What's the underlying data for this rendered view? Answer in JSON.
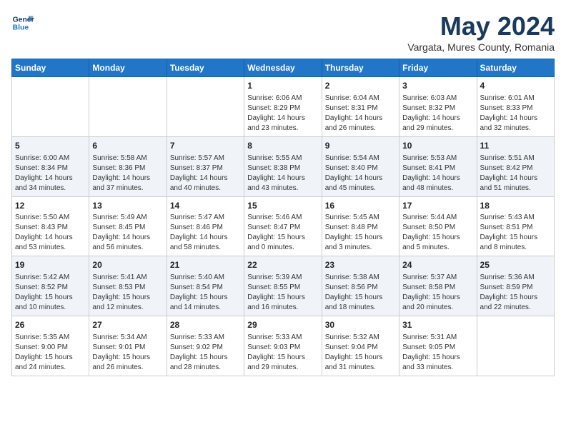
{
  "logo": {
    "line1": "General",
    "line2": "Blue"
  },
  "title": "May 2024",
  "location": "Vargata, Mures County, Romania",
  "weekdays": [
    "Sunday",
    "Monday",
    "Tuesday",
    "Wednesday",
    "Thursday",
    "Friday",
    "Saturday"
  ],
  "weeks": [
    [
      {
        "day": "",
        "info": ""
      },
      {
        "day": "",
        "info": ""
      },
      {
        "day": "",
        "info": ""
      },
      {
        "day": "1",
        "info": "Sunrise: 6:06 AM\nSunset: 8:29 PM\nDaylight: 14 hours\nand 23 minutes."
      },
      {
        "day": "2",
        "info": "Sunrise: 6:04 AM\nSunset: 8:31 PM\nDaylight: 14 hours\nand 26 minutes."
      },
      {
        "day": "3",
        "info": "Sunrise: 6:03 AM\nSunset: 8:32 PM\nDaylight: 14 hours\nand 29 minutes."
      },
      {
        "day": "4",
        "info": "Sunrise: 6:01 AM\nSunset: 8:33 PM\nDaylight: 14 hours\nand 32 minutes."
      }
    ],
    [
      {
        "day": "5",
        "info": "Sunrise: 6:00 AM\nSunset: 8:34 PM\nDaylight: 14 hours\nand 34 minutes."
      },
      {
        "day": "6",
        "info": "Sunrise: 5:58 AM\nSunset: 8:36 PM\nDaylight: 14 hours\nand 37 minutes."
      },
      {
        "day": "7",
        "info": "Sunrise: 5:57 AM\nSunset: 8:37 PM\nDaylight: 14 hours\nand 40 minutes."
      },
      {
        "day": "8",
        "info": "Sunrise: 5:55 AM\nSunset: 8:38 PM\nDaylight: 14 hours\nand 43 minutes."
      },
      {
        "day": "9",
        "info": "Sunrise: 5:54 AM\nSunset: 8:40 PM\nDaylight: 14 hours\nand 45 minutes."
      },
      {
        "day": "10",
        "info": "Sunrise: 5:53 AM\nSunset: 8:41 PM\nDaylight: 14 hours\nand 48 minutes."
      },
      {
        "day": "11",
        "info": "Sunrise: 5:51 AM\nSunset: 8:42 PM\nDaylight: 14 hours\nand 51 minutes."
      }
    ],
    [
      {
        "day": "12",
        "info": "Sunrise: 5:50 AM\nSunset: 8:43 PM\nDaylight: 14 hours\nand 53 minutes."
      },
      {
        "day": "13",
        "info": "Sunrise: 5:49 AM\nSunset: 8:45 PM\nDaylight: 14 hours\nand 56 minutes."
      },
      {
        "day": "14",
        "info": "Sunrise: 5:47 AM\nSunset: 8:46 PM\nDaylight: 14 hours\nand 58 minutes."
      },
      {
        "day": "15",
        "info": "Sunrise: 5:46 AM\nSunset: 8:47 PM\nDaylight: 15 hours\nand 0 minutes."
      },
      {
        "day": "16",
        "info": "Sunrise: 5:45 AM\nSunset: 8:48 PM\nDaylight: 15 hours\nand 3 minutes."
      },
      {
        "day": "17",
        "info": "Sunrise: 5:44 AM\nSunset: 8:50 PM\nDaylight: 15 hours\nand 5 minutes."
      },
      {
        "day": "18",
        "info": "Sunrise: 5:43 AM\nSunset: 8:51 PM\nDaylight: 15 hours\nand 8 minutes."
      }
    ],
    [
      {
        "day": "19",
        "info": "Sunrise: 5:42 AM\nSunset: 8:52 PM\nDaylight: 15 hours\nand 10 minutes."
      },
      {
        "day": "20",
        "info": "Sunrise: 5:41 AM\nSunset: 8:53 PM\nDaylight: 15 hours\nand 12 minutes."
      },
      {
        "day": "21",
        "info": "Sunrise: 5:40 AM\nSunset: 8:54 PM\nDaylight: 15 hours\nand 14 minutes."
      },
      {
        "day": "22",
        "info": "Sunrise: 5:39 AM\nSunset: 8:55 PM\nDaylight: 15 hours\nand 16 minutes."
      },
      {
        "day": "23",
        "info": "Sunrise: 5:38 AM\nSunset: 8:56 PM\nDaylight: 15 hours\nand 18 minutes."
      },
      {
        "day": "24",
        "info": "Sunrise: 5:37 AM\nSunset: 8:58 PM\nDaylight: 15 hours\nand 20 minutes."
      },
      {
        "day": "25",
        "info": "Sunrise: 5:36 AM\nSunset: 8:59 PM\nDaylight: 15 hours\nand 22 minutes."
      }
    ],
    [
      {
        "day": "26",
        "info": "Sunrise: 5:35 AM\nSunset: 9:00 PM\nDaylight: 15 hours\nand 24 minutes."
      },
      {
        "day": "27",
        "info": "Sunrise: 5:34 AM\nSunset: 9:01 PM\nDaylight: 15 hours\nand 26 minutes."
      },
      {
        "day": "28",
        "info": "Sunrise: 5:33 AM\nSunset: 9:02 PM\nDaylight: 15 hours\nand 28 minutes."
      },
      {
        "day": "29",
        "info": "Sunrise: 5:33 AM\nSunset: 9:03 PM\nDaylight: 15 hours\nand 29 minutes."
      },
      {
        "day": "30",
        "info": "Sunrise: 5:32 AM\nSunset: 9:04 PM\nDaylight: 15 hours\nand 31 minutes."
      },
      {
        "day": "31",
        "info": "Sunrise: 5:31 AM\nSunset: 9:05 PM\nDaylight: 15 hours\nand 33 minutes."
      },
      {
        "day": "",
        "info": ""
      }
    ]
  ]
}
